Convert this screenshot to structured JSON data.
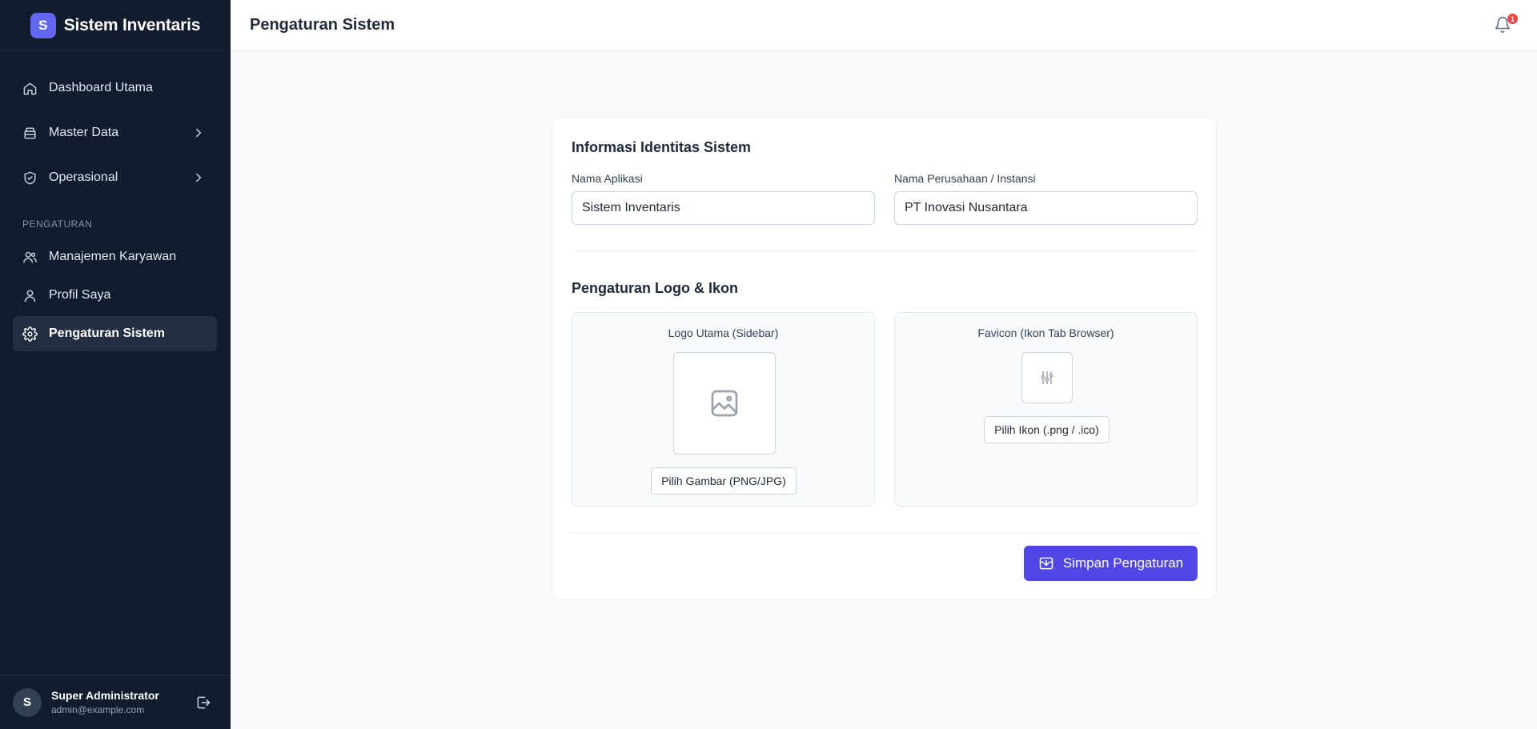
{
  "app": {
    "brand_initial": "S",
    "brand_title": "Sistem Inventaris"
  },
  "sidebar": {
    "items": [
      {
        "label": "Dashboard Utama",
        "icon": "home-icon"
      },
      {
        "label": "Master Data",
        "icon": "archive-icon"
      },
      {
        "label": "Operasional",
        "icon": "shield-check-icon"
      }
    ],
    "section_label": "PENGATURAN",
    "settings_items": [
      {
        "label": "Manajemen Karyawan",
        "icon": "users-icon"
      },
      {
        "label": "Profil Saya",
        "icon": "user-icon"
      },
      {
        "label": "Pengaturan Sistem",
        "icon": "gear-icon",
        "active": true
      }
    ],
    "user": {
      "initial": "S",
      "name": "Super Administrator",
      "email": "admin@example.com"
    }
  },
  "header": {
    "title": "Pengaturan Sistem",
    "notification_count": "1"
  },
  "form": {
    "identity_title": "Informasi Identitas Sistem",
    "app_name_label": "Nama Aplikasi",
    "app_name_value": "Sistem Inventaris",
    "company_label": "Nama Perusahaan / Instansi",
    "company_value": "PT Inovasi Nusantara",
    "logo_section_title": "Pengaturan Logo & Ikon",
    "logo_title": "Logo Utama (Sidebar)",
    "logo_button": "Pilih Gambar (PNG/JPG)",
    "favicon_title": "Favicon (Ikon Tab Browser)",
    "favicon_button": "Pilih Ikon (.png / .ico)",
    "save_label": "Simpan Pengaturan"
  },
  "colors": {
    "sidebar_bg": "#131c2e",
    "accent": "#4f46e5",
    "brand_badge": "#6366f1",
    "notification": "#ef4444"
  }
}
